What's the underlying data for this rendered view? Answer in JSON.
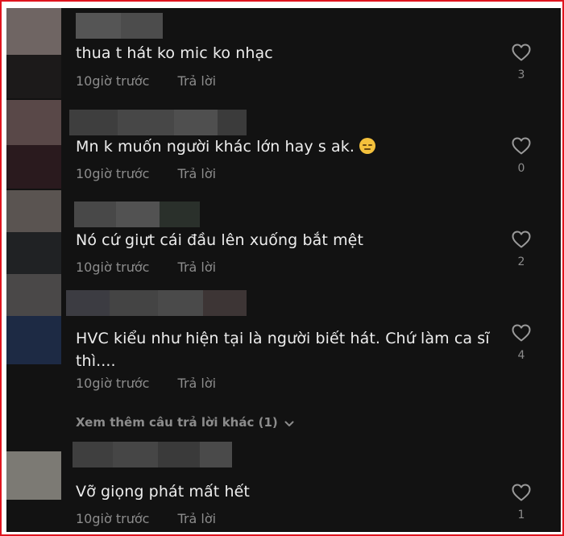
{
  "comments": [
    {
      "text": "thua t hát ko mic ko nhạc",
      "time": "10giờ trước",
      "reply": "Trả lời",
      "likes": "3"
    },
    {
      "text": "Mn k muốn người khác lớn hay s ak.",
      "time": "10giờ trước",
      "reply": "Trả lời",
      "likes": "0",
      "emoji": "pensive-face-emoji"
    },
    {
      "text": "Nó cứ giựt cái đầu lên xuống bắt mệt",
      "time": "10giờ trước",
      "reply": "Trả lời",
      "likes": "2"
    },
    {
      "text": "HVC kiểu như hiện tại là người biết hát. Chứ làm ca sĩ thì....",
      "time": "10giờ trước",
      "reply": "Trả lời",
      "likes": "4"
    },
    {
      "text": "Vỡ giọng phát mất hết",
      "time": "10giờ trước",
      "reply": "Trả lời",
      "likes": "1"
    }
  ],
  "view_more_replies": "Xem thêm câu trả lời khác (1)",
  "icons": {
    "like": "heart-outline-icon",
    "expand": "chevron-down-icon"
  },
  "colors": {
    "frame_border": "#e0141e",
    "background": "#121212",
    "text": "#ededed",
    "secondary_text": "#8c8c8c"
  }
}
